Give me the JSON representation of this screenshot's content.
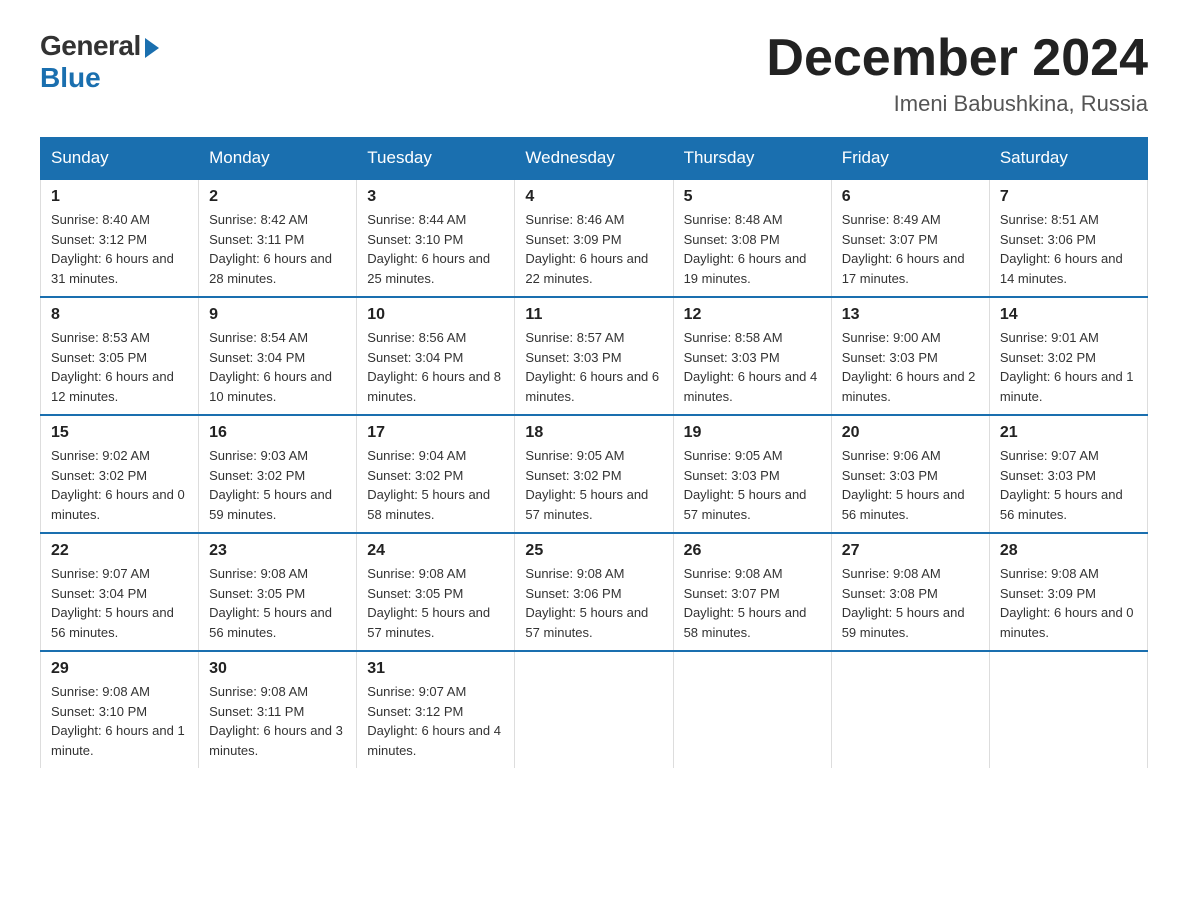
{
  "logo": {
    "general": "General",
    "blue": "Blue"
  },
  "title": "December 2024",
  "location": "Imeni Babushkina, Russia",
  "days_of_week": [
    "Sunday",
    "Monday",
    "Tuesday",
    "Wednesday",
    "Thursday",
    "Friday",
    "Saturday"
  ],
  "weeks": [
    [
      {
        "day": "1",
        "sunrise": "8:40 AM",
        "sunset": "3:12 PM",
        "daylight": "6 hours and 31 minutes."
      },
      {
        "day": "2",
        "sunrise": "8:42 AM",
        "sunset": "3:11 PM",
        "daylight": "6 hours and 28 minutes."
      },
      {
        "day": "3",
        "sunrise": "8:44 AM",
        "sunset": "3:10 PM",
        "daylight": "6 hours and 25 minutes."
      },
      {
        "day": "4",
        "sunrise": "8:46 AM",
        "sunset": "3:09 PM",
        "daylight": "6 hours and 22 minutes."
      },
      {
        "day": "5",
        "sunrise": "8:48 AM",
        "sunset": "3:08 PM",
        "daylight": "6 hours and 19 minutes."
      },
      {
        "day": "6",
        "sunrise": "8:49 AM",
        "sunset": "3:07 PM",
        "daylight": "6 hours and 17 minutes."
      },
      {
        "day": "7",
        "sunrise": "8:51 AM",
        "sunset": "3:06 PM",
        "daylight": "6 hours and 14 minutes."
      }
    ],
    [
      {
        "day": "8",
        "sunrise": "8:53 AM",
        "sunset": "3:05 PM",
        "daylight": "6 hours and 12 minutes."
      },
      {
        "day": "9",
        "sunrise": "8:54 AM",
        "sunset": "3:04 PM",
        "daylight": "6 hours and 10 minutes."
      },
      {
        "day": "10",
        "sunrise": "8:56 AM",
        "sunset": "3:04 PM",
        "daylight": "6 hours and 8 minutes."
      },
      {
        "day": "11",
        "sunrise": "8:57 AM",
        "sunset": "3:03 PM",
        "daylight": "6 hours and 6 minutes."
      },
      {
        "day": "12",
        "sunrise": "8:58 AM",
        "sunset": "3:03 PM",
        "daylight": "6 hours and 4 minutes."
      },
      {
        "day": "13",
        "sunrise": "9:00 AM",
        "sunset": "3:03 PM",
        "daylight": "6 hours and 2 minutes."
      },
      {
        "day": "14",
        "sunrise": "9:01 AM",
        "sunset": "3:02 PM",
        "daylight": "6 hours and 1 minute."
      }
    ],
    [
      {
        "day": "15",
        "sunrise": "9:02 AM",
        "sunset": "3:02 PM",
        "daylight": "6 hours and 0 minutes."
      },
      {
        "day": "16",
        "sunrise": "9:03 AM",
        "sunset": "3:02 PM",
        "daylight": "5 hours and 59 minutes."
      },
      {
        "day": "17",
        "sunrise": "9:04 AM",
        "sunset": "3:02 PM",
        "daylight": "5 hours and 58 minutes."
      },
      {
        "day": "18",
        "sunrise": "9:05 AM",
        "sunset": "3:02 PM",
        "daylight": "5 hours and 57 minutes."
      },
      {
        "day": "19",
        "sunrise": "9:05 AM",
        "sunset": "3:03 PM",
        "daylight": "5 hours and 57 minutes."
      },
      {
        "day": "20",
        "sunrise": "9:06 AM",
        "sunset": "3:03 PM",
        "daylight": "5 hours and 56 minutes."
      },
      {
        "day": "21",
        "sunrise": "9:07 AM",
        "sunset": "3:03 PM",
        "daylight": "5 hours and 56 minutes."
      }
    ],
    [
      {
        "day": "22",
        "sunrise": "9:07 AM",
        "sunset": "3:04 PM",
        "daylight": "5 hours and 56 minutes."
      },
      {
        "day": "23",
        "sunrise": "9:08 AM",
        "sunset": "3:05 PM",
        "daylight": "5 hours and 56 minutes."
      },
      {
        "day": "24",
        "sunrise": "9:08 AM",
        "sunset": "3:05 PM",
        "daylight": "5 hours and 57 minutes."
      },
      {
        "day": "25",
        "sunrise": "9:08 AM",
        "sunset": "3:06 PM",
        "daylight": "5 hours and 57 minutes."
      },
      {
        "day": "26",
        "sunrise": "9:08 AM",
        "sunset": "3:07 PM",
        "daylight": "5 hours and 58 minutes."
      },
      {
        "day": "27",
        "sunrise": "9:08 AM",
        "sunset": "3:08 PM",
        "daylight": "5 hours and 59 minutes."
      },
      {
        "day": "28",
        "sunrise": "9:08 AM",
        "sunset": "3:09 PM",
        "daylight": "6 hours and 0 minutes."
      }
    ],
    [
      {
        "day": "29",
        "sunrise": "9:08 AM",
        "sunset": "3:10 PM",
        "daylight": "6 hours and 1 minute."
      },
      {
        "day": "30",
        "sunrise": "9:08 AM",
        "sunset": "3:11 PM",
        "daylight": "6 hours and 3 minutes."
      },
      {
        "day": "31",
        "sunrise": "9:07 AM",
        "sunset": "3:12 PM",
        "daylight": "6 hours and 4 minutes."
      },
      null,
      null,
      null,
      null
    ]
  ],
  "labels": {
    "sunrise": "Sunrise:",
    "sunset": "Sunset:",
    "daylight": "Daylight:"
  }
}
